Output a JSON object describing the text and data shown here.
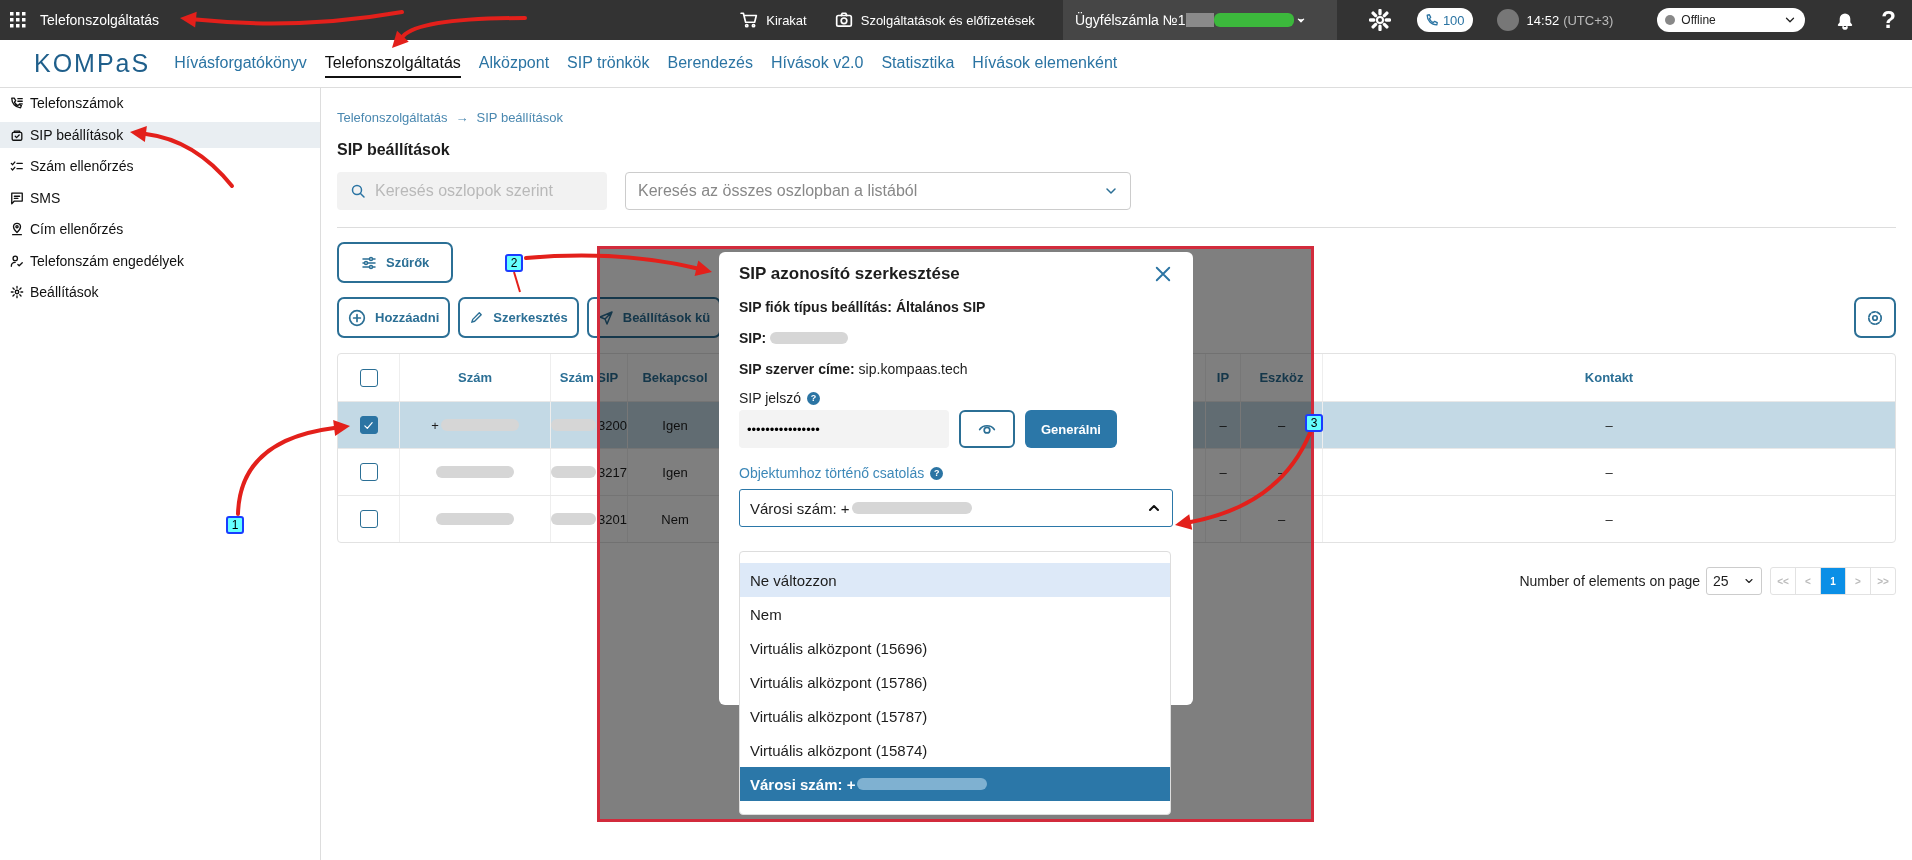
{
  "top_bar": {
    "title": "Telefonszolgáltatás",
    "shop": "Kirakat",
    "services": "Szolgáltatások és előfizetések",
    "account": "Ügyfélszámla №1",
    "calls": "100",
    "time": "14:52",
    "timezone": "(UTC+3)",
    "status": "Offline",
    "help": "?"
  },
  "nav": {
    "logo": "KOMPaS",
    "tabs": [
      {
        "label": "Hívásforgatókönyv",
        "selected": false
      },
      {
        "label": "Telefonszolgáltatás",
        "selected": true
      },
      {
        "label": "Alközpont",
        "selected": false
      },
      {
        "label": "SIP trönkök",
        "selected": false
      },
      {
        "label": "Berendezés",
        "selected": false
      },
      {
        "label": "Hívások v2.0",
        "selected": false
      },
      {
        "label": "Statisztika",
        "selected": false
      },
      {
        "label": "Hívások elemenként",
        "selected": false
      }
    ]
  },
  "sidebar": {
    "items": [
      {
        "label": "Telefonszámok",
        "selected": false
      },
      {
        "label": "SIP beállítások",
        "selected": true
      },
      {
        "label": "Szám ellenőrzés",
        "selected": false
      },
      {
        "label": "SMS",
        "selected": false
      },
      {
        "label": "Cím ellenőrzés",
        "selected": false
      },
      {
        "label": "Telefonszám engedélyek",
        "selected": false
      },
      {
        "label": "Beállítások",
        "selected": false
      }
    ]
  },
  "breadcrumb": {
    "items": [
      "Telefonszolgáltatás",
      "SIP beállítások"
    ],
    "separator": "→"
  },
  "page_title": "SIP beállítások",
  "search": {
    "placeholder": "Keresés oszlopok szerint"
  },
  "column_search": {
    "placeholder": "Keresés az összes oszlopban a listából"
  },
  "filters_button": "Szűrők",
  "actions": [
    "Hozzáadni",
    "Szerkesztés",
    "Beállítások kü"
  ],
  "table": {
    "all_checked": false,
    "columns": [
      "Szám",
      "Szám SIP",
      "Bekapcsol",
      "IP",
      "Eszköz",
      "Kontakt"
    ],
    "rows": [
      {
        "selected": true,
        "number_prefix": "+",
        "sip_suffix": "3200",
        "enabled": "Igen",
        "ip": "–",
        "device": "–",
        "contact": "–"
      },
      {
        "selected": false,
        "sip_suffix": "3217",
        "enabled": "Igen",
        "ip": "–",
        "device": "–",
        "contact": "–"
      },
      {
        "selected": false,
        "sip_suffix": "3201",
        "enabled": "Nem",
        "ip": "–",
        "device": "–",
        "contact": "–"
      }
    ]
  },
  "pagination": {
    "label": "Number of elements on page",
    "page_size": "25",
    "pages": [
      {
        "label": "<<",
        "selected": false,
        "disabled": true
      },
      {
        "label": "<",
        "selected": false,
        "disabled": true
      },
      {
        "label": "1",
        "selected": true,
        "disabled": false
      },
      {
        "label": ">",
        "selected": false,
        "disabled": true
      },
      {
        "label": ">>",
        "selected": false,
        "disabled": true
      }
    ]
  },
  "modal": {
    "title": "SIP azonosító szerkesztése",
    "account_type": "SIP fiók típus beállítás: Általános SIP",
    "sip_label": "SIP:",
    "server": "**SIP szerver címe:** sip.kompaas.tech",
    "password_label": "SIP jelszó",
    "help_mark": "?",
    "password": "••••••••••••••••",
    "generate_button": "Generálni",
    "binding_label": "Objektumhoz történő csatolás",
    "binding_value": "Városi szám: +",
    "options": [
      {
        "label": "Ne változzon",
        "selected": false,
        "highlighted": true
      },
      {
        "label": "Nem",
        "selected": false,
        "highlighted": false
      },
      {
        "label": "Virtuális alközpont (15696)",
        "selected": false,
        "highlighted": false
      },
      {
        "label": "Virtuális alközpont (15786)",
        "selected": false,
        "highlighted": false
      },
      {
        "label": "Virtuális alközpont (15787)",
        "selected": false,
        "highlighted": false
      },
      {
        "label": "Virtuális alközpont (15874)",
        "selected": false,
        "highlighted": false
      },
      {
        "label": "Városi szám: +",
        "selected": true,
        "highlighted": false,
        "redacted": true
      }
    ]
  },
  "annotations": [
    {
      "label": "1"
    },
    {
      "label": "2"
    },
    {
      "label": "3"
    }
  ]
}
